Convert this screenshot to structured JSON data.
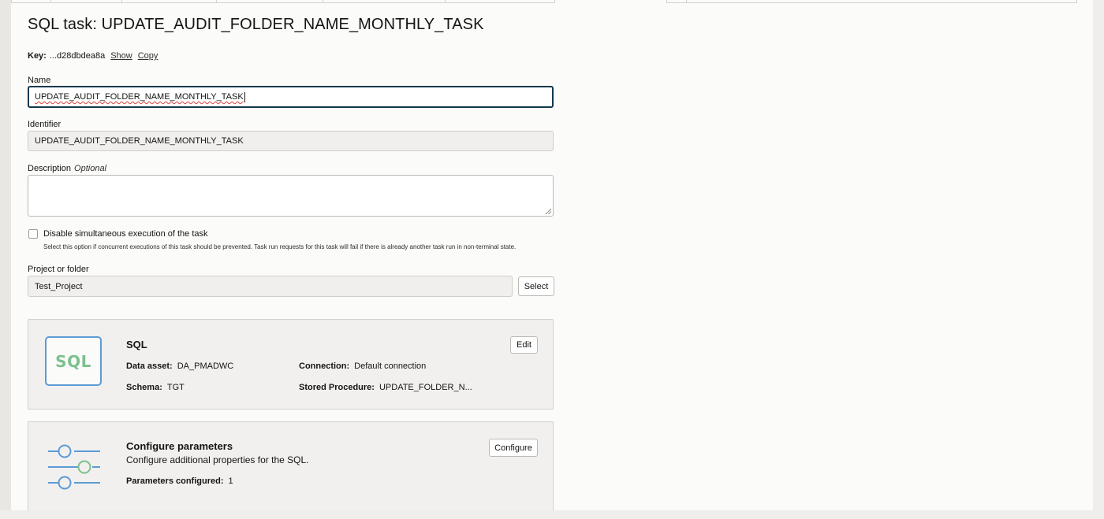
{
  "page": {
    "title": "SQL task: UPDATE_AUDIT_FOLDER_NAME_MONTHLY_TASK"
  },
  "key": {
    "label": "Key:",
    "value": "...d28dbdea8a",
    "show_link": "Show",
    "copy_link": "Copy"
  },
  "form": {
    "name_label": "Name",
    "name_value": "UPDATE_AUDIT_FOLDER_NAME_MONTHLY_TASK",
    "identifier_label": "Identifier",
    "identifier_value": "UPDATE_AUDIT_FOLDER_NAME_MONTHLY_TASK",
    "description_label": "Description",
    "description_optional": "Optional",
    "description_value": "",
    "disable_concurrent_label": "Disable simultaneous execution of the task",
    "disable_concurrent_checked": false,
    "disable_concurrent_help": "Select this option if concurrent executions of this task should be prevented. Task run requests for this task will fail if there is already another task run in non-terminal state.",
    "project_label": "Project or folder",
    "project_value": "Test_Project",
    "select_button": "Select"
  },
  "sql_card": {
    "icon_text": "SQL",
    "title": "SQL",
    "edit_button": "Edit",
    "data_asset_label": "Data asset:",
    "data_asset_value": "DA_PMADWC",
    "connection_label": "Connection:",
    "connection_value": "Default connection",
    "schema_label": "Schema:",
    "schema_value": "TGT",
    "stored_procedure_label": "Stored Procedure:",
    "stored_procedure_value": "UPDATE_FOLDER_N..."
  },
  "params_card": {
    "title": "Configure parameters",
    "subtitle": "Configure additional properties for the SQL.",
    "configure_button": "Configure",
    "params_configured_label": "Parameters configured:",
    "params_configured_value": "1"
  },
  "icons": {
    "sliders": "sliders-icon",
    "sql": "sql-icon",
    "resize": "resize-grip-icon"
  },
  "colors": {
    "accent_blue": "#5b9bd5",
    "accent_green": "#7cc08e",
    "focus_border": "#13384e"
  }
}
